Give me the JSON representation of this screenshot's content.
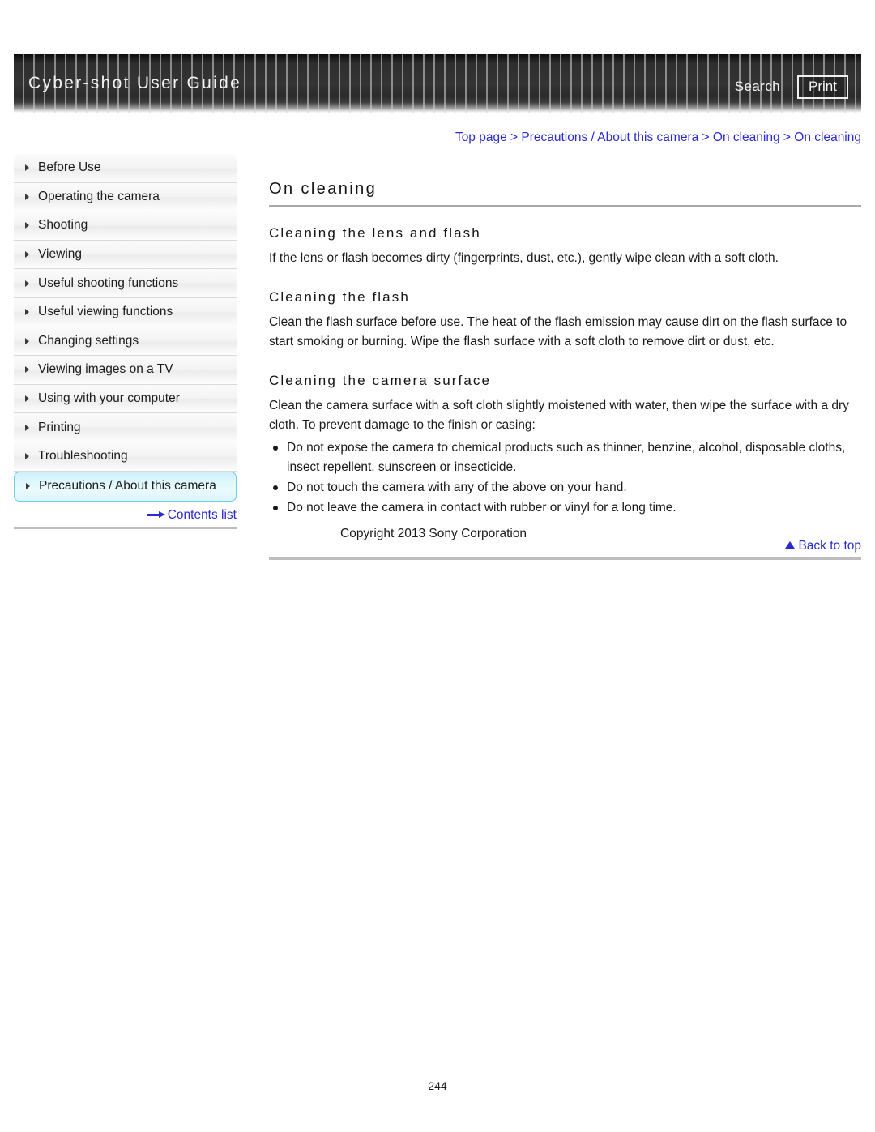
{
  "header": {
    "title": "Cyber-shot User Guide",
    "search_label": "Search",
    "print_label": "Print"
  },
  "breadcrumb": {
    "text": "Top page > Precautions / About this camera > On cleaning > On cleaning"
  },
  "sidebar": {
    "items": [
      {
        "label": "Before Use",
        "active": false
      },
      {
        "label": "Operating the camera",
        "active": false
      },
      {
        "label": "Shooting",
        "active": false
      },
      {
        "label": "Viewing",
        "active": false
      },
      {
        "label": "Useful shooting functions",
        "active": false
      },
      {
        "label": "Useful viewing functions",
        "active": false
      },
      {
        "label": "Changing settings",
        "active": false
      },
      {
        "label": "Viewing images on a TV",
        "active": false
      },
      {
        "label": "Using with your computer",
        "active": false
      },
      {
        "label": "Printing",
        "active": false
      },
      {
        "label": "Troubleshooting",
        "active": false
      },
      {
        "label": "Precautions / About this camera",
        "active": true
      }
    ],
    "contents_list_label": "Contents list"
  },
  "main": {
    "page_title": "On cleaning",
    "sections": [
      {
        "heading": "Cleaning the lens and flash",
        "paragraphs": [
          "If the lens or flash becomes dirty (fingerprints, dust, etc.), gently wipe clean with a soft cloth."
        ]
      },
      {
        "heading": "Cleaning the flash",
        "paragraphs": [
          "Clean the flash surface before use. The heat of the flash emission may cause dirt on the flash surface to start smoking or burning. Wipe the flash surface with a soft cloth to remove dirt or dust, etc."
        ]
      },
      {
        "heading": "Cleaning the camera surface",
        "paragraphs": [
          "Clean the camera surface with a soft cloth slightly moistened with water, then wipe the surface with a dry cloth. To prevent damage to the finish or casing:"
        ],
        "bullets": [
          "Do not expose the camera to chemical products such as thinner, benzine, alcohol, disposable cloths, insect repellent, sunscreen or insecticide.",
          "Do not touch the camera with any of the above on your hand.",
          "Do not leave the camera in contact with rubber or vinyl for a long time."
        ]
      }
    ],
    "back_to_top_label": "Back to top"
  },
  "footer": {
    "copyright": "Copyright 2013 Sony Corporation",
    "page_number": "244"
  },
  "colors": {
    "link": "#2a2ad0",
    "active_item_bg": "#dff7fd",
    "active_item_border": "#6fcfe4",
    "rule": "#bdbdbd"
  }
}
